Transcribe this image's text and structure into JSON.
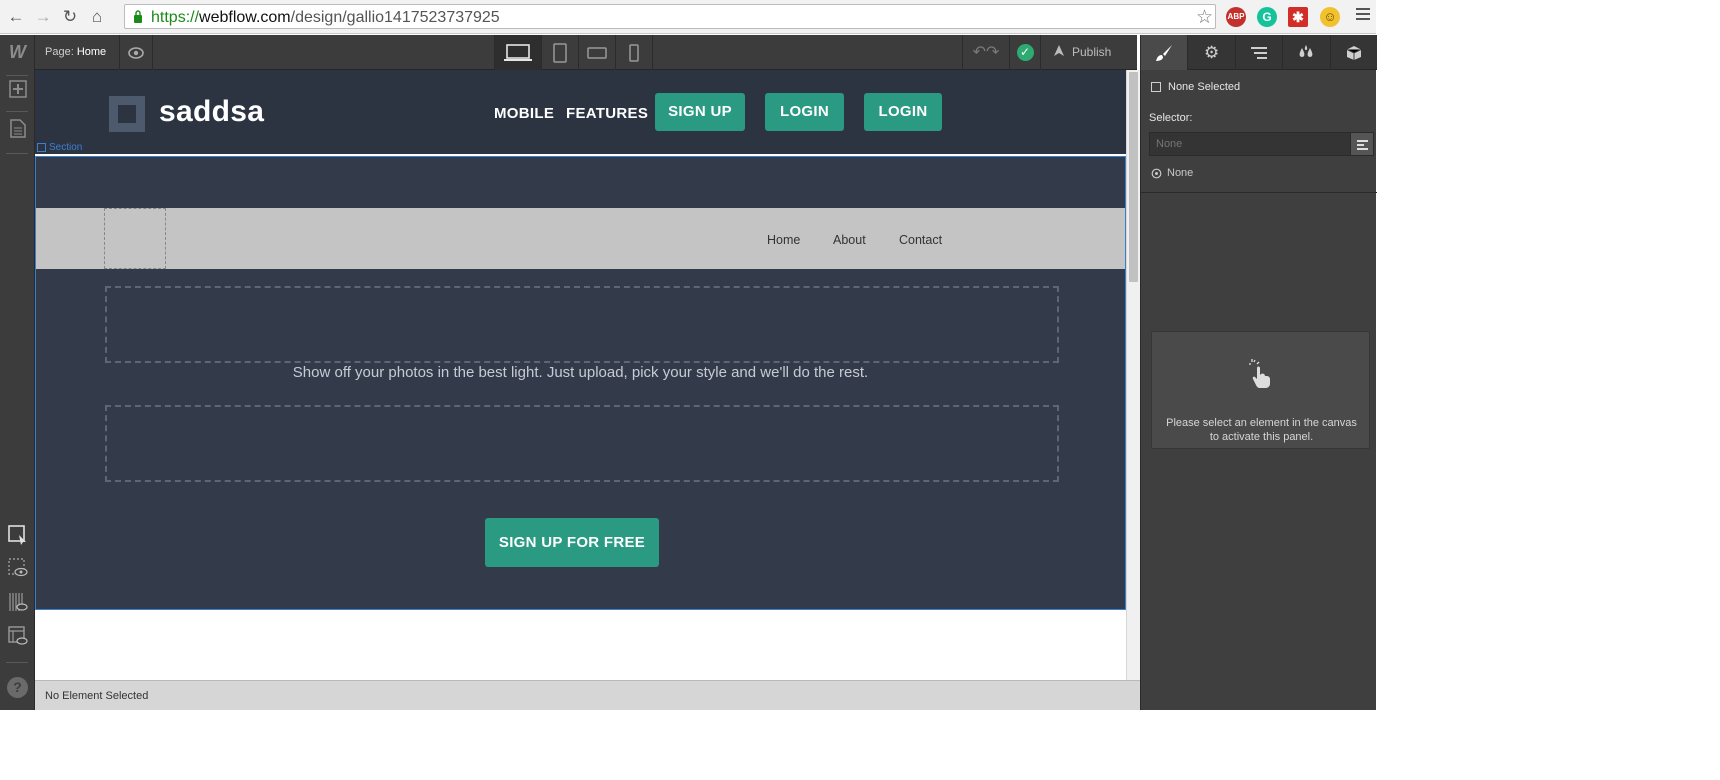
{
  "browser": {
    "url_protocol": "https://",
    "url_host": "webflow.com",
    "url_path": "/design/gallio1417523737925",
    "extensions": [
      "ABP",
      "grammarly",
      "lastpass",
      "smiley"
    ]
  },
  "left_toolbar": {
    "icons": [
      "webflow-logo-icon",
      "add-icon",
      "pages-icon",
      "select-icon",
      "preview-icon",
      "grid-icon",
      "layout-icon",
      "help-icon"
    ]
  },
  "topbar": {
    "page_prefix": "Page:",
    "page_name": "Home",
    "publish_label": "Publish",
    "devices": [
      "desktop",
      "tablet",
      "mobile-landscape",
      "mobile-portrait"
    ]
  },
  "site": {
    "brand": "saddsa",
    "nav_links": [
      "MOBILE",
      "FEATURES"
    ],
    "buttons": [
      "SIGN UP",
      "LOGIN",
      "LOGIN"
    ],
    "section_tag": "Section",
    "navbar_links": [
      "Home",
      "About",
      "Contact"
    ],
    "tagline": "Show off your photos in the best light.  Just upload, pick your style and we'll do the rest.",
    "cta": "SIGN UP FOR FREE",
    "accent_color": "#2a9a83"
  },
  "status": {
    "text": "No Element Selected"
  },
  "right_panel": {
    "tabs": [
      "brush-icon",
      "gear-icon",
      "navigator-icon",
      "drops-icon",
      "box-icon"
    ],
    "selection": "None Selected",
    "selector_label": "Selector:",
    "selector_placeholder": "None",
    "none_label": "None",
    "hint": "Please select an element in the canvas to activate this panel."
  }
}
